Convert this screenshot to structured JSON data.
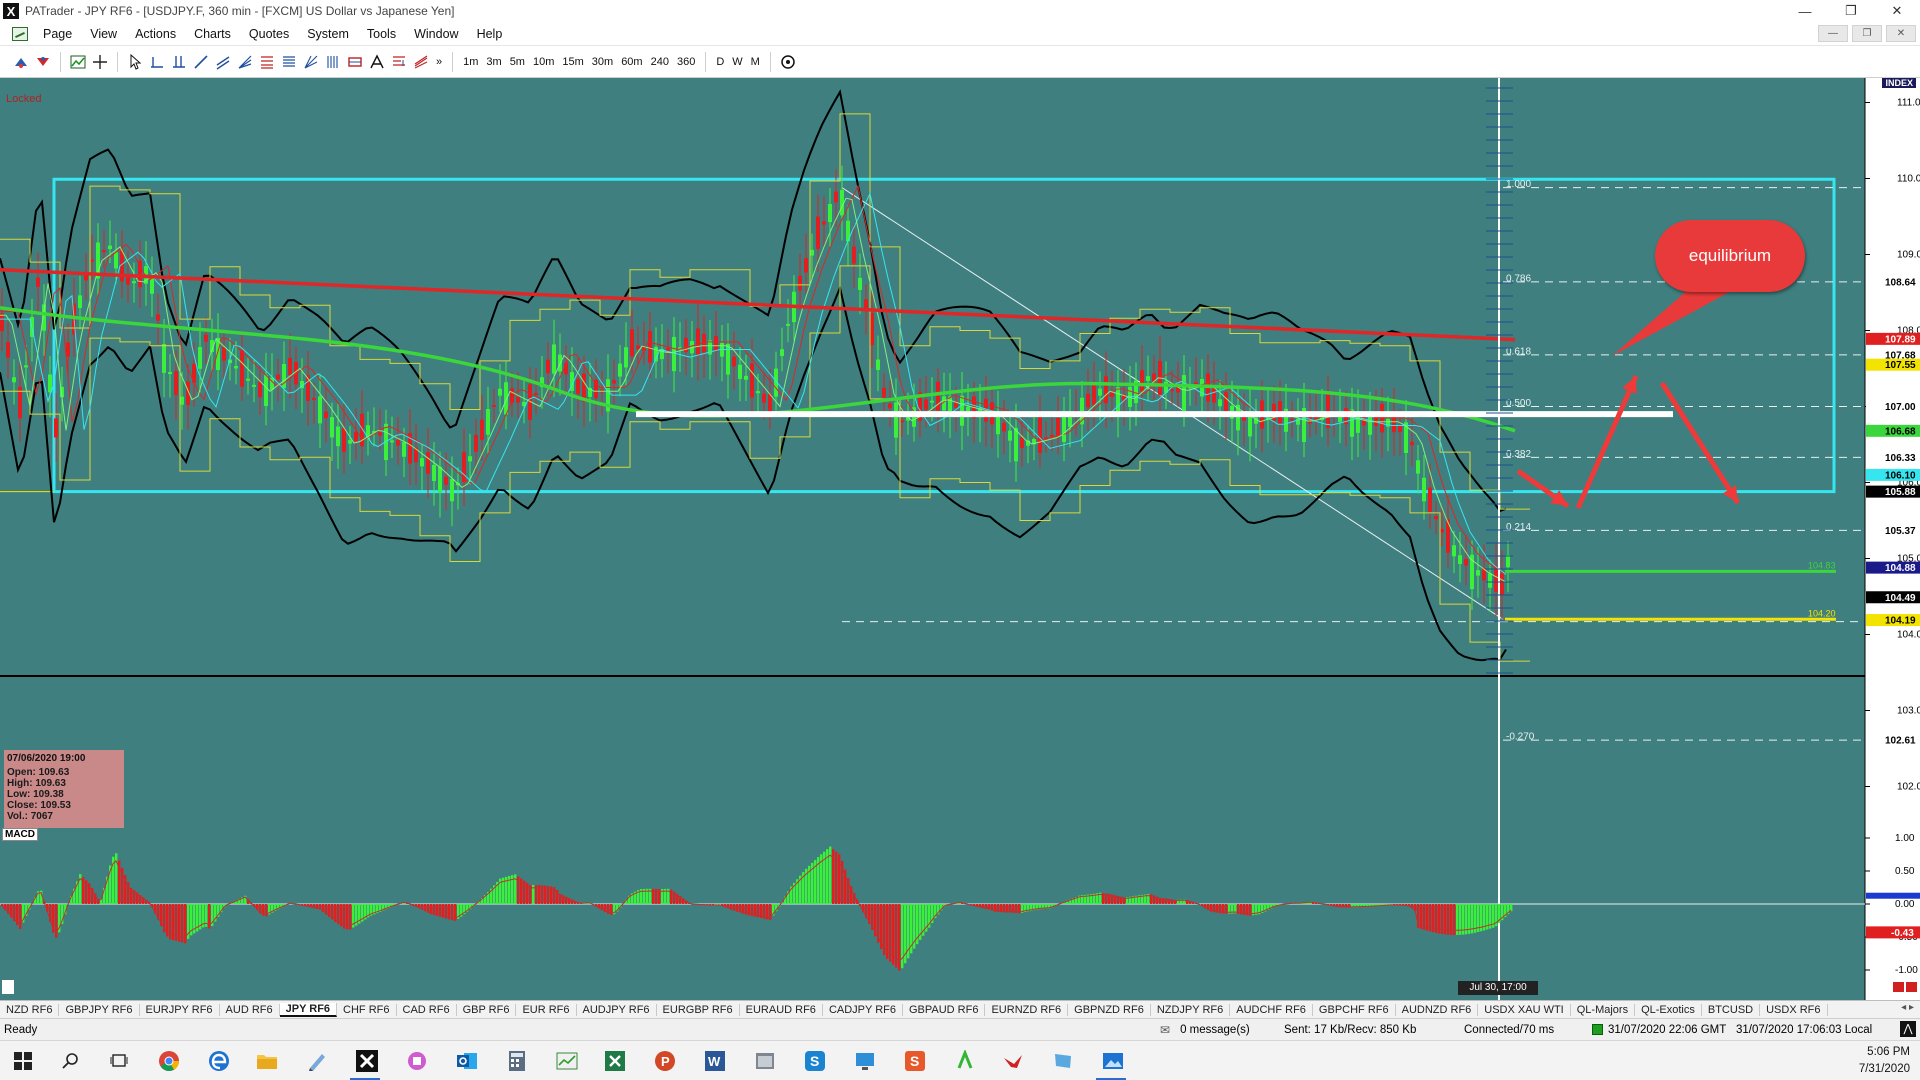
{
  "window": {
    "title": "PATrader - JPY RF6 - [USDJPY.F, 360 min - [FXCM] US Dollar vs Japanese Yen]",
    "controls": [
      "—",
      "❐",
      "✕"
    ]
  },
  "menu": {
    "items": [
      "Page",
      "View",
      "Actions",
      "Charts",
      "Quotes",
      "System",
      "Tools",
      "Window",
      "Help"
    ]
  },
  "toolbar": {
    "timeframes": [
      "1m",
      "3m",
      "5m",
      "10m",
      "15m",
      "30m",
      "60m",
      "240",
      "360"
    ],
    "periods": [
      "D",
      "W",
      "M"
    ],
    "more": "»"
  },
  "chart": {
    "locked_label": "Locked",
    "index_label": "INDEX",
    "annotation": "equilibrium",
    "time_flag": "Jul 30, 17:00",
    "macd_label": "MACD",
    "ohlc": {
      "time": "07/06/2020 19:00",
      "open": "Open: 109.63",
      "high": "High: 109.63",
      "low": "Low: 109.38",
      "close": "Close: 109.53",
      "vol": "Vol.: 7067"
    },
    "colors": {
      "background": "#3f7f7f",
      "range_box": "#35e6f0",
      "sma": "#e02626",
      "ema": "#3bd63b",
      "bands": "#000000"
    }
  },
  "chart_data": {
    "type": "line",
    "symbol": "USDJPY.F",
    "timeframe": "360 min",
    "price_axis_ticks": [
      "111.00",
      "110.00",
      "109.00",
      "108.00",
      "107.00",
      "106.00",
      "105.00",
      "104.00",
      "103.00",
      "102.00"
    ],
    "price_tags": [
      {
        "value": "108.64",
        "bg": "#ffffff",
        "fg": "#000000"
      },
      {
        "value": "107.89",
        "bg": "#e02020",
        "fg": "#ffffff"
      },
      {
        "value": "107.68",
        "bg": "#ffffff",
        "fg": "#000000"
      },
      {
        "value": "107.55",
        "bg": "#f3e300",
        "fg": "#000000"
      },
      {
        "value": "107.00",
        "bg": "#ffffff",
        "fg": "#000000"
      },
      {
        "value": "106.68",
        "bg": "#3bd63b",
        "fg": "#000000"
      },
      {
        "value": "106.33",
        "bg": "#ffffff",
        "fg": "#000000"
      },
      {
        "value": "106.10",
        "bg": "#35e6f0",
        "fg": "#000000"
      },
      {
        "value": "105.88",
        "bg": "#000000",
        "fg": "#ffffff"
      },
      {
        "value": "105.37",
        "bg": "#ffffff",
        "fg": "#000000"
      },
      {
        "value": "104.88",
        "bg": "#1a1a8a",
        "fg": "#ffffff"
      },
      {
        "value": "104.49",
        "bg": "#000000",
        "fg": "#ffffff"
      },
      {
        "value": "104.19",
        "bg": "#f3e300",
        "fg": "#000000"
      },
      {
        "value": "102.61",
        "bg": "#ffffff",
        "fg": "#000000"
      }
    ],
    "fib_levels": [
      {
        "ratio": "1.000",
        "value": 109.88
      },
      {
        "ratio": "0.786",
        "value": 108.64
      },
      {
        "ratio": "0.618",
        "value": 107.68
      },
      {
        "ratio": "0.500",
        "value": 107.0
      },
      {
        "ratio": "0.382",
        "value": 106.33
      },
      {
        "ratio": "0.214",
        "value": 105.37
      },
      {
        "ratio": "-0.270",
        "value": 102.61
      }
    ],
    "position_lines": [
      {
        "label": "104.83",
        "value": 104.83,
        "color": "#3bd63b"
      },
      {
        "label": "104.20",
        "value": 104.2,
        "color": "#f3e300"
      }
    ],
    "macd_axis_ticks": [
      "1.00",
      "0.50",
      "0.00",
      "-0.50",
      "-1.00"
    ],
    "macd_tags": [
      {
        "value": "-0.43",
        "bg": "#e02020",
        "fg": "#ffffff"
      }
    ],
    "range_box": {
      "top": 109.99,
      "bottom": 105.88
    },
    "equilibrium_level": 106.9,
    "ylim": [
      101.0,
      111.1
    ]
  },
  "tabs": {
    "items": [
      "NZD RF6",
      "GBPJPY RF6",
      "EURJPY RF6",
      "AUD RF6",
      "JPY RF6",
      "CHF RF6",
      "CAD RF6",
      "GBP RF6",
      "EUR RF6",
      "AUDJPY RF6",
      "EURGBP RF6",
      "EURAUD RF6",
      "CADJPY RF6",
      "GBPAUD RF6",
      "EURNZD RF6",
      "GBPNZD RF6",
      "NZDJPY RF6",
      "AUDCHF RF6",
      "GBPCHF RF6",
      "AUDNZD RF6",
      "USDX XAU WTI",
      "QL-Majors",
      "QL-Exotics",
      "BTCUSD",
      "USDX RF6"
    ],
    "active": "JPY RF6"
  },
  "status": {
    "ready": "Ready",
    "messages": "0 message(s)",
    "traffic": "Sent: 17 Kb/Recv: 850 Kb",
    "connection": "Connected/70 ms",
    "gmt_time": "31/07/2020 22:06 GMT",
    "local_time": "31/07/2020 17:06:03 Local"
  },
  "taskbar": {
    "time": "5:06 PM",
    "date": "7/31/2020"
  }
}
